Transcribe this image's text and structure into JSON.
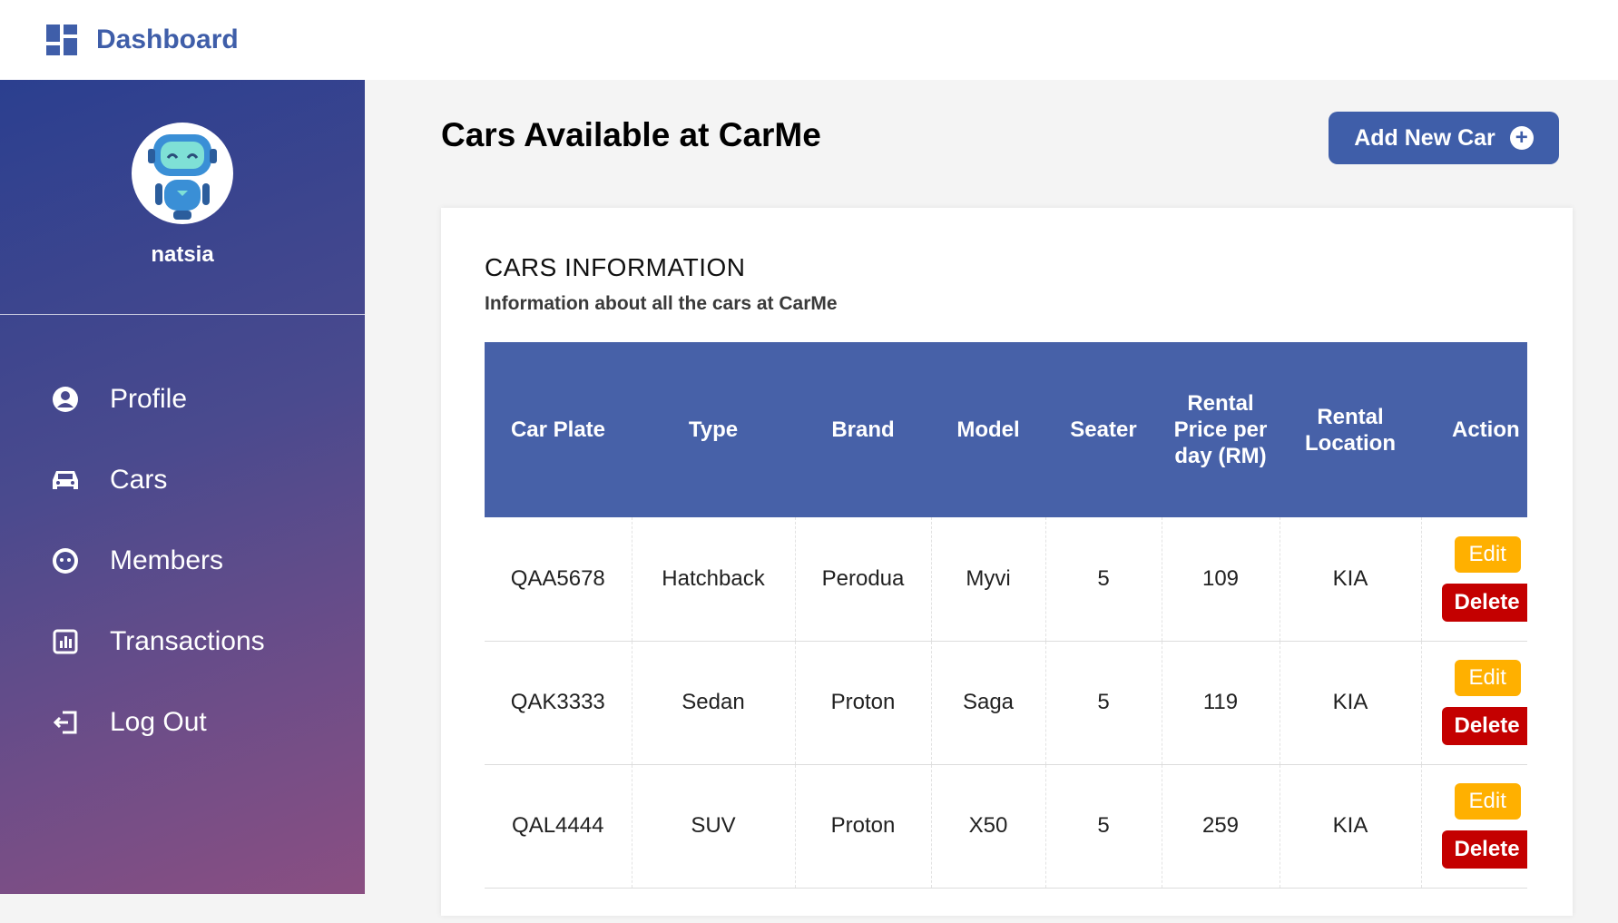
{
  "topbar": {
    "title": "Dashboard",
    "icon": "dashboard-grid-icon",
    "title_color": "#3f5ea9"
  },
  "sidebar": {
    "username": "natsia",
    "avatar_icon": "robot-avatar",
    "items": [
      {
        "label": "Profile",
        "icon": "user-circle-icon"
      },
      {
        "label": "Cars",
        "icon": "car-icon"
      },
      {
        "label": "Members",
        "icon": "members-face-icon"
      },
      {
        "label": "Transactions",
        "icon": "chart-bar-icon"
      },
      {
        "label": "Log Out",
        "icon": "logout-icon"
      }
    ]
  },
  "main": {
    "title": "Cars Available at CarMe",
    "add_button_label": "Add New Car",
    "accent_color": "#3f5ea9"
  },
  "card": {
    "title": "CARS INFORMATION",
    "subtitle": "Information about all the cars at CarMe"
  },
  "table": {
    "headers": [
      "Car Plate",
      "Type",
      "Brand",
      "Model",
      "Seater",
      "Rental Price per day (RM)",
      "Rental Location",
      "Action"
    ],
    "rows": [
      {
        "plate": "QAA5678",
        "type": "Hatchback",
        "brand": "Perodua",
        "model": "Myvi",
        "seater": "5",
        "price": "109",
        "location": "KIA"
      },
      {
        "plate": "QAK3333",
        "type": "Sedan",
        "brand": "Proton",
        "model": "Saga",
        "seater": "5",
        "price": "119",
        "location": "KIA"
      },
      {
        "plate": "QAL4444",
        "type": "SUV",
        "brand": "Proton",
        "model": "X50",
        "seater": "5",
        "price": "259",
        "location": "KIA"
      }
    ],
    "edit_label": "Edit",
    "delete_label": "Delete",
    "edit_color": "#ffb000",
    "delete_color": "#c40000"
  }
}
